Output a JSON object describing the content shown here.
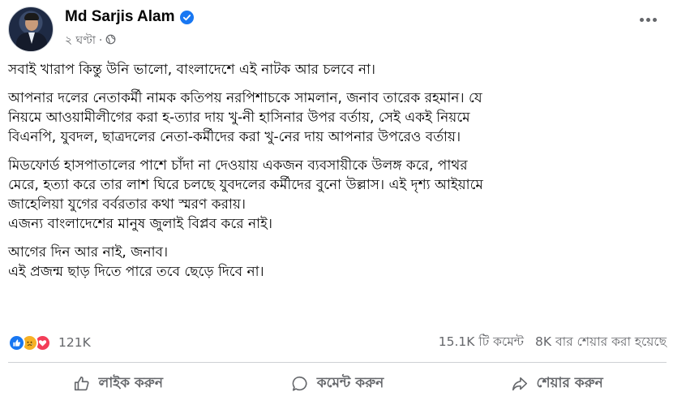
{
  "post": {
    "author": "Md Sarjis Alam",
    "time": "২ ঘণ্টা",
    "separator": "·",
    "paragraphs": [
      "সবাই খারাপ কিন্তু উনি ভালো, বাংলাদেশে এই নাটক আর চলবে না।",
      "আপনার দলের নেতাকর্মী নামক কতিপয় নরপিশাচকে সামলান, জনাব তারেক রহমান। যে\nনিয়মে আওয়ামীলীগের করা হ-ত্যার দায় খু-নী হাসিনার উপর বর্তায়, সেই একই নিয়মে\nবিএনপি, যুবদল, ছাত্রদলের নেতা-কর্মীদের করা খু-নের দায় আপনার উপরেও বর্তায়।",
      "মিডফোর্ড হাসপাতালের পাশে চাঁদা না দেওয়ায় একজন ব্যবসায়ীকে উলঙ্গ করে, পাথর\nমেরে, হত্যা করে তার লাশ ঘিরে চলছে যুবদলের কর্মীদের বুনো উল্লাস। এই দৃশ্য আইয়ামে\nজাহেলিয়া যুগের বর্বরতার কথা স্মরণ করায়।\nএজন্য বাংলাদেশের মানুষ জুলাই বিপ্লব করে নাই।",
      "আগের দিন আর নাই, জনাব।\nএই প্রজন্ম ছাড় দিতে পারে তবে ছেড়ে দিবে না।"
    ]
  },
  "stats": {
    "reactions": "121K",
    "comments": "15.1K টি কমেন্ট",
    "shares": "8K বার শেয়ার করা হয়েছে"
  },
  "actions": {
    "like": "লাইক করুন",
    "comment": "কমেন্ট করুন",
    "share": "শেয়ার করুন"
  },
  "icons": {
    "verified": "verified-badge-icon",
    "audience": "globe-icon",
    "more": "more-options-icon"
  },
  "colors": {
    "brand": "#1877f2",
    "muted": "#65676b",
    "love": "#f33e58",
    "sad": "#f7b125"
  }
}
